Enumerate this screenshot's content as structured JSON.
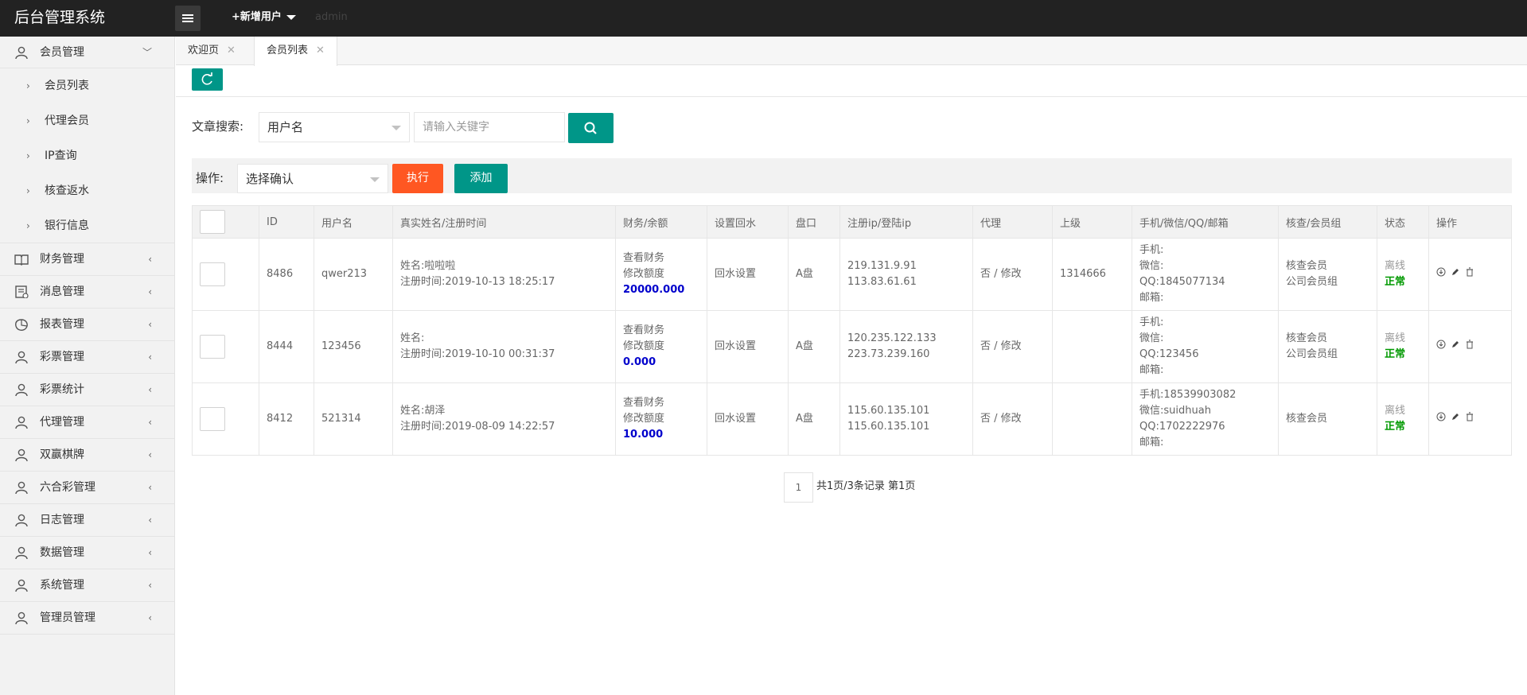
{
  "app": {
    "title": "后台管理系统"
  },
  "topbar": {
    "add_user_label": "+新增用户",
    "username": "admin"
  },
  "sidebar": {
    "member_group": {
      "label": "会员管理",
      "icon": "user-icon",
      "expanded": true
    },
    "sub_items": [
      "会员列表",
      "代理会员",
      "IP查询",
      "核查返水",
      "银行信息"
    ],
    "groups": [
      {
        "label": "财务管理",
        "icon": "book-icon"
      },
      {
        "label": "消息管理",
        "icon": "message-icon"
      },
      {
        "label": "报表管理",
        "icon": "chart-icon"
      },
      {
        "label": "彩票管理",
        "icon": "user-icon"
      },
      {
        "label": "彩票统计",
        "icon": "user-icon"
      },
      {
        "label": "代理管理",
        "icon": "user-icon"
      },
      {
        "label": "双赢棋牌",
        "icon": "user-icon"
      },
      {
        "label": "六合彩管理",
        "icon": "user-icon"
      },
      {
        "label": "日志管理",
        "icon": "user-icon"
      },
      {
        "label": "数据管理",
        "icon": "user-icon"
      },
      {
        "label": "系统管理",
        "icon": "user-icon"
      },
      {
        "label": "管理员管理",
        "icon": "user-icon"
      }
    ]
  },
  "tabs": [
    {
      "label": "欢迎页",
      "active": false
    },
    {
      "label": "会员列表",
      "active": true
    }
  ],
  "search": {
    "label": "文章搜索:",
    "field_selected": "用户名",
    "keyword_placeholder": "请输入关键字"
  },
  "operations": {
    "label": "操作:",
    "select_value": "选择确认",
    "execute_label": "执行",
    "add_label": "添加"
  },
  "colors": {
    "primary": "#009688",
    "danger": "#ff5722",
    "balance": "#0000cc",
    "status_ok": "#009900"
  },
  "table": {
    "headers": [
      "ID",
      "用户名",
      "真实姓名/注册时间",
      "财务/余额",
      "设置回水",
      "盘口",
      "注册ip/登陆ip",
      "代理",
      "上级",
      "手机/微信/QQ/邮箱",
      "核查/会员组",
      "状态",
      "操作"
    ],
    "rows": [
      {
        "id": "8486",
        "username": "qwer213",
        "name": "姓名:啦啦啦",
        "reg_time": "注册时间:2019-10-13 18:25:17",
        "finance_view": "查看财务",
        "finance_edit": "修改额度",
        "balance": "20000.000",
        "rebate": "回水设置",
        "pan": "A盘",
        "reg_ip": "219.131.9.91",
        "login_ip": "113.83.61.61",
        "agent": "否 / 修改",
        "superior": "1314666",
        "phone": "手机:",
        "wechat": "微信:",
        "qq": "QQ:1845077134",
        "email": "邮箱:",
        "check": "核查会员",
        "group": "公司会员组",
        "online": "离线",
        "status": "正常"
      },
      {
        "id": "8444",
        "username": "123456",
        "name": "姓名:",
        "reg_time": "注册时间:2019-10-10 00:31:37",
        "finance_view": "查看财务",
        "finance_edit": "修改额度",
        "balance": "0.000",
        "rebate": "回水设置",
        "pan": "A盘",
        "reg_ip": "120.235.122.133",
        "login_ip": "223.73.239.160",
        "agent": "否 / 修改",
        "superior": "",
        "phone": "手机:",
        "wechat": "微信:",
        "qq": "QQ:123456",
        "email": "邮箱:",
        "check": "核查会员",
        "group": "公司会员组",
        "online": "离线",
        "status": "正常"
      },
      {
        "id": "8412",
        "username": "521314",
        "name": "姓名:胡泽",
        "reg_time": "注册时间:2019-08-09 14:22:57",
        "finance_view": "查看财务",
        "finance_edit": "修改额度",
        "balance": "10.000",
        "rebate": "回水设置",
        "pan": "A盘",
        "reg_ip": "115.60.135.101",
        "login_ip": "115.60.135.101",
        "agent": "否 / 修改",
        "superior": "",
        "phone": "手机:18539903082",
        "wechat": "微信:suidhuah",
        "qq": "QQ:1702222976",
        "email": "邮箱:",
        "check": "核查会员",
        "group": "",
        "online": "离线",
        "status": "正常"
      }
    ]
  },
  "pagination": {
    "current_page": "1",
    "summary": "共1页/3条记录 第1页"
  }
}
